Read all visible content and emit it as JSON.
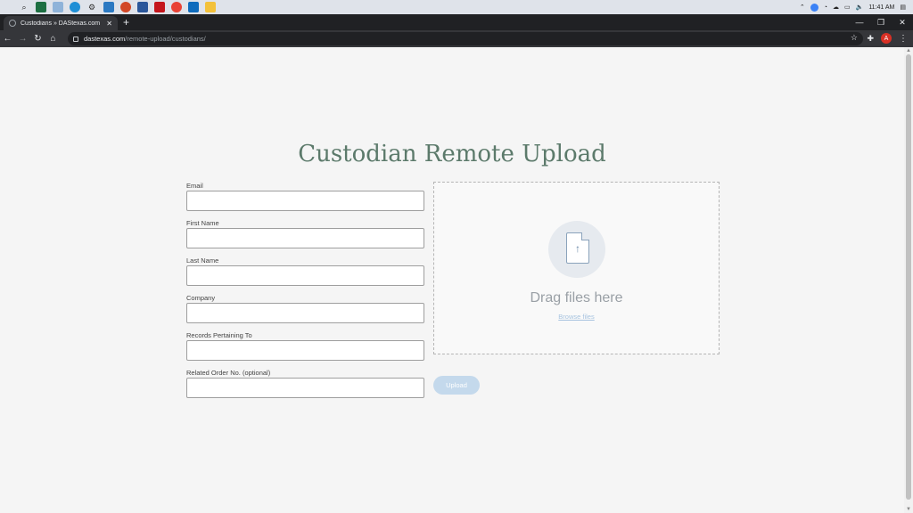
{
  "taskbar": {
    "clock": "11:41 AM"
  },
  "browser": {
    "tab_title": "Custodians » DAStexas.com",
    "tab_close": "✕",
    "new_tab": "+",
    "url_host": "dastexas.com",
    "url_path": "/remote-upload/custodians/",
    "avatar_letter": "A"
  },
  "page": {
    "heading": "Custodian Remote Upload",
    "fields": [
      {
        "label": "Email"
      },
      {
        "label": "First Name"
      },
      {
        "label": "Last Name"
      },
      {
        "label": "Company"
      },
      {
        "label": "Records Pertaining To"
      },
      {
        "label": "Related Order No. (optional)"
      }
    ],
    "dropzone": {
      "text": "Drag files here",
      "browse_link": "Browse files"
    },
    "upload_button": "Upload"
  }
}
